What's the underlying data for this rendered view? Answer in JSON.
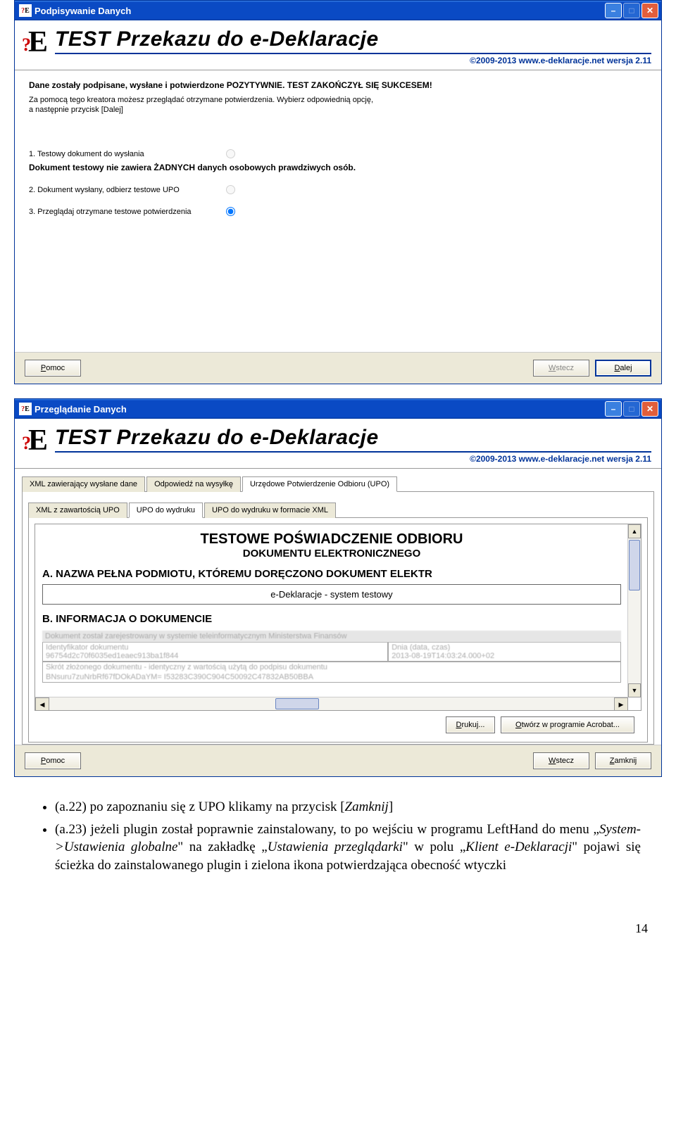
{
  "win1": {
    "title": "Podpisywanie Danych",
    "header_title": "TEST Przekazu do e-Deklaracje",
    "header_sub": "©2009-2013 www.e-deklaracje.net wersja 2.11",
    "success_line": "Dane zostały podpisane, wysłane i potwierdzone POZYTYWNIE. TEST ZAKOŃCZYŁ SIĘ SUKCESEM!",
    "info_line1": "Za pomocą tego kreatora możesz przeglądać otrzymane potwierdzenia. Wybierz odpowiednią opcję,",
    "info_line2": "a następnie przycisk [Dalej]",
    "opt1": "1. Testowy dokument do wysłania",
    "note_bold": "Dokument testowy nie zawiera ŻADNYCH danych osobowych prawdziwych osób.",
    "opt2": "2. Dokument wysłany, odbierz testowe UPO",
    "opt3": "3. Przeglądaj otrzymane testowe potwierdzenia",
    "btn_help": "Pomoc",
    "btn_back": "Wstecz",
    "btn_next": "Dalej"
  },
  "win2": {
    "title": "Przeglądanie Danych",
    "header_title": "TEST Przekazu do e-Deklaracje",
    "header_sub": "©2009-2013 www.e-deklaracje.net wersja 2.11",
    "tabs_top": {
      "t1": "XML zawierający wysłane dane",
      "t2": "Odpowiedź na wysyłkę",
      "t3": "Urzędowe Potwierdzenie Odbioru (UPO)"
    },
    "tabs_sub": {
      "t1": "XML z zawartością UPO",
      "t2": "UPO do wydruku",
      "t3": "UPO do wydruku w formacie XML"
    },
    "upo": {
      "title": "TESTOWE POŚWIADCZENIE ODBIORU",
      "subtitle": "DOKUMENTU ELEKTRONICZNEGO",
      "sectA": "A. NAZWA PEŁNA PODMIOTU, KTÓREMU DORĘCZONO DOKUMENT ELEKTR",
      "fieldA": "e-Deklaracje - system testowy",
      "sectB": "B. INFORMACJA O DOKUMENCIE",
      "grey1": "Dokument został zarejestrowany w systemie teleinformatycznym Ministerstwa Finansów",
      "lbl_id": "Identyfikator dokumentu",
      "val_id": "96754d2c70f6035ed1eaec913ba1f844",
      "lbl_date": "Dnia (data, czas)",
      "val_date": "2013-08-19T14:03:24.000+02",
      "grey2": "Skrót złożonego dokumentu - identyczny z wartością użytą do podpisu dokumentu",
      "val_hash": "BNsuru7zuNrbRf67fDOkADaYM= I53283C390C904C50092C47832AB50BBA"
    },
    "btn_print": "Drukuj...",
    "btn_open": "Otwórz w programie Acrobat...",
    "btn_help": "Pomoc",
    "btn_back": "Wstecz",
    "btn_close": "Zamknij"
  },
  "bullets": {
    "b1_pre": "(a.22) po zapoznaniu się z UPO klikamy na przycisk [",
    "b1_em": "Zamknij",
    "b1_post": "]",
    "b2_pre": "(a.23) jeżeli plugin został poprawnie zainstalowany, to po wejściu w programu LeftHand do menu „",
    "b2_em1": "System->Ustawienia globalne",
    "b2_mid1": "\" na zakładkę „",
    "b2_em2": "Ustawienia przeglądarki",
    "b2_mid2": "\" w polu „",
    "b2_em3": "Klient e-Deklaracji",
    "b2_post": "\" pojawi się ścieżka do zainstalowanego plugin i zielona ikona potwierdzająca obecność wtyczki"
  },
  "page_number": "14"
}
